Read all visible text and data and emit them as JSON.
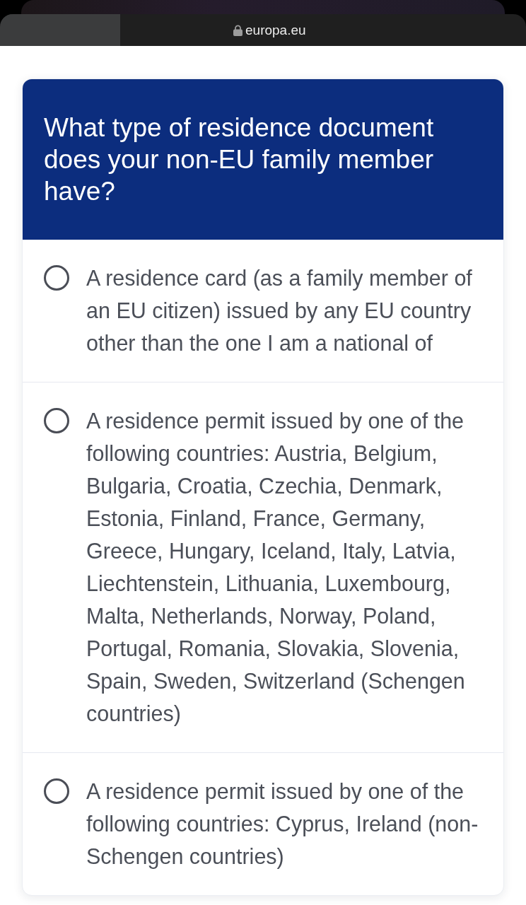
{
  "browser": {
    "url": "europa.eu"
  },
  "question": {
    "title": "What type of residence document does your non-EU family member have?"
  },
  "options": [
    {
      "label": "A residence card (as a family member of an EU citizen) issued by any EU country other than the one I am a national of",
      "selected": false
    },
    {
      "label": "A residence permit issued by one of the following countries: Austria, Belgium, Bulgaria, Croatia, Czechia, Denmark, Estonia, Finland, France, Germany, Greece, Hungary, Iceland, Italy, Latvia, Liechtenstein, Lithuania, Luxembourg, Malta, Netherlands, Norway, Poland, Portugal, Romania, Slovakia, Slovenia, Spain, Sweden, Switzerland (Schengen countries)",
      "selected": false
    },
    {
      "label": "A residence permit issued by one of the following countries: Cyprus, Ireland (non-Schengen countries)",
      "selected": false
    }
  ]
}
